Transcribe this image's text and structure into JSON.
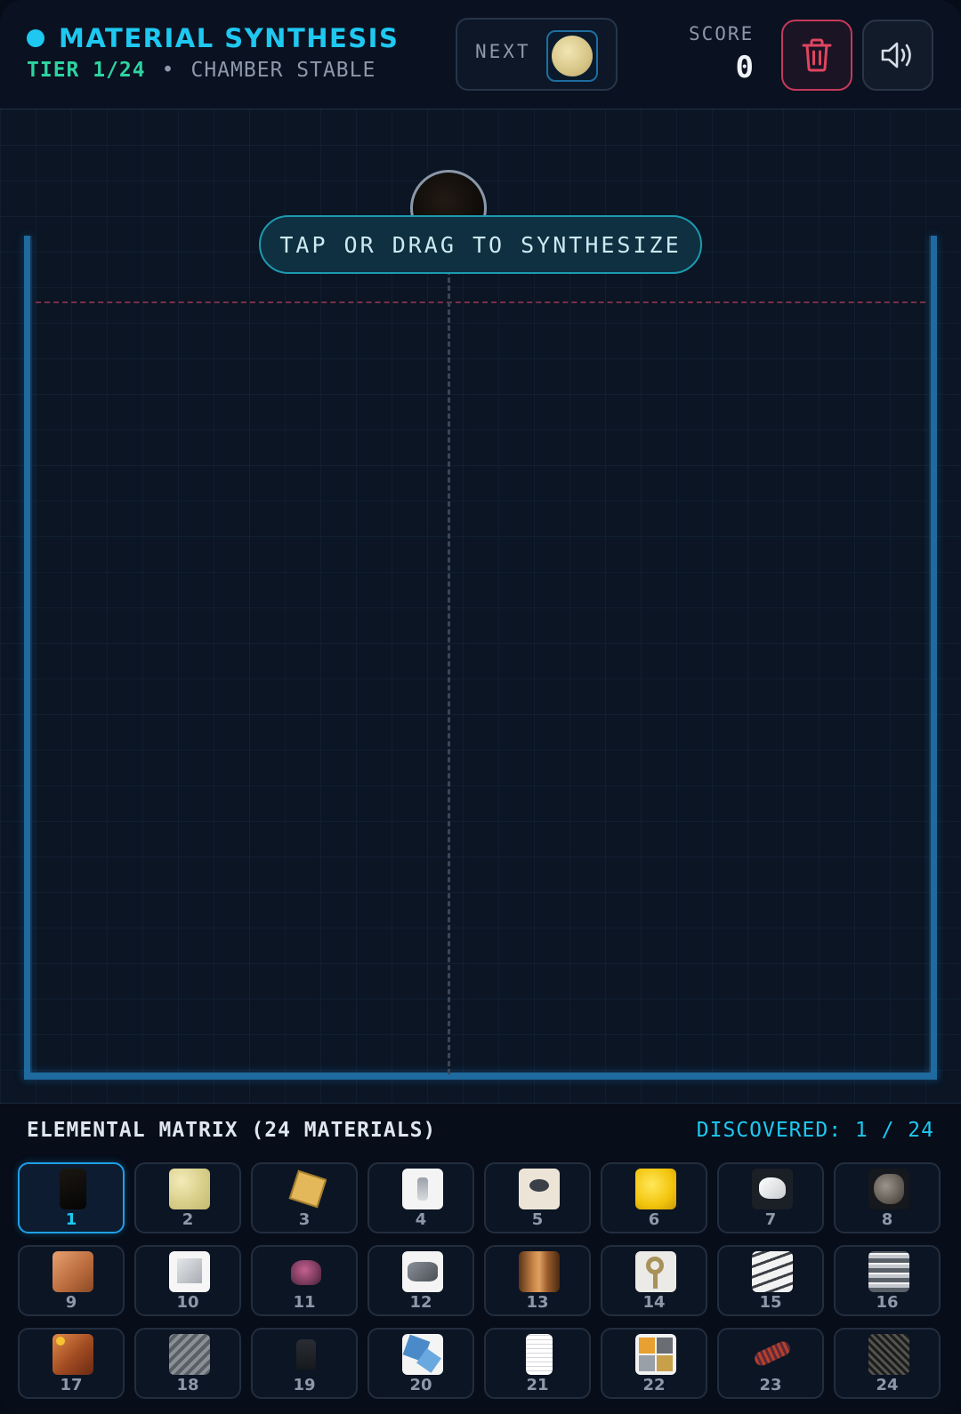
{
  "header": {
    "title": "MATERIAL SYNTHESIS",
    "tier": "TIER 1/24",
    "separator": "•",
    "status": "CHAMBER STABLE",
    "next_label": "NEXT",
    "score_label": "SCORE",
    "score_value": "0",
    "trash_icon": "trash-icon",
    "sound_icon": "speaker-icon",
    "accent_color": "#1ec8f0",
    "tier_color": "#2ed3a0",
    "danger_color": "#c43a5a"
  },
  "arena": {
    "hint": "TAP OR DRAG TO SYNTHESIZE"
  },
  "matrix": {
    "title": "ELEMENTAL MATRIX (24 MATERIALS)",
    "discovered": "DISCOVERED: 1 / 24",
    "selected": "1",
    "materials": [
      {
        "num": "1"
      },
      {
        "num": "2"
      },
      {
        "num": "3"
      },
      {
        "num": "4"
      },
      {
        "num": "5"
      },
      {
        "num": "6"
      },
      {
        "num": "7"
      },
      {
        "num": "8"
      },
      {
        "num": "9"
      },
      {
        "num": "10"
      },
      {
        "num": "11"
      },
      {
        "num": "12"
      },
      {
        "num": "13"
      },
      {
        "num": "14"
      },
      {
        "num": "15"
      },
      {
        "num": "16"
      },
      {
        "num": "17"
      },
      {
        "num": "18"
      },
      {
        "num": "19"
      },
      {
        "num": "20"
      },
      {
        "num": "21"
      },
      {
        "num": "22"
      },
      {
        "num": "23"
      },
      {
        "num": "24"
      }
    ]
  }
}
